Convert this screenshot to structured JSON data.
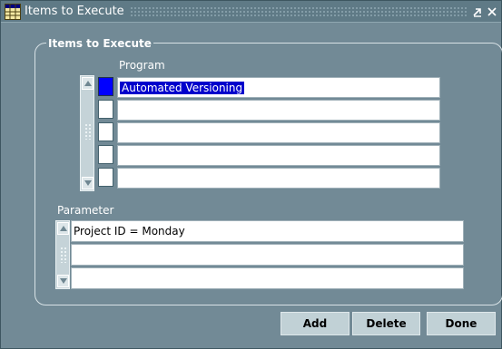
{
  "window": {
    "title": "Items to Execute",
    "icon": "grid-table-icon",
    "controls": [
      "minimize-icon",
      "close-icon"
    ]
  },
  "group": {
    "title": "Items to Execute"
  },
  "program": {
    "header": "Program",
    "rows": [
      "Automated Versioning",
      "",
      "",
      "",
      ""
    ],
    "selected_row": 0
  },
  "parameter": {
    "header": "Parameter",
    "rows": [
      "Project ID = Monday",
      "",
      ""
    ]
  },
  "buttons": {
    "add": "Add",
    "delete": "Delete",
    "done": "Done"
  },
  "colors": {
    "accent_selected": "#0000ff",
    "window_bg": "#728a96",
    "button_bg": "#c1d1d6"
  }
}
